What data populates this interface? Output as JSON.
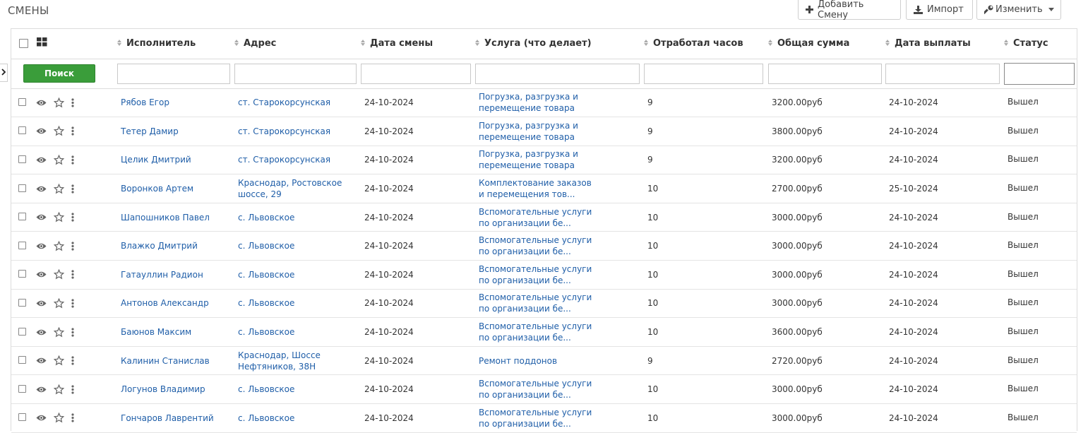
{
  "page": {
    "title": "СМЕНЫ"
  },
  "toolbar": {
    "add_label": "Добавить Смену",
    "import_label": "Импорт",
    "edit_label": "Изменить"
  },
  "search": {
    "button_label": "Поиск"
  },
  "columns": [
    "Исполнитель",
    "Адрес",
    "Дата смены",
    "Услуга (что делает)",
    "Отработал часов",
    "Общая сумма",
    "Дата выплаты",
    "Статус"
  ],
  "rows": [
    {
      "worker": "Рябов Егор",
      "address": "ст. Старокорсунская",
      "date": "24-10-2024",
      "service": "Погрузка, разгрузка и перемещение товара",
      "hours": "9",
      "sum": "3200.00руб",
      "pay_date": "24-10-2024",
      "status": "Вышел"
    },
    {
      "worker": "Тетер Дамир",
      "address": "ст. Старокорсунская",
      "date": "24-10-2024",
      "service": "Погрузка, разгрузка и перемещение товара",
      "hours": "9",
      "sum": "3800.00руб",
      "pay_date": "24-10-2024",
      "status": "Вышел"
    },
    {
      "worker": "Целик Дмитрий",
      "address": "ст. Старокорсунская",
      "date": "24-10-2024",
      "service": "Погрузка, разгрузка и перемещение товара",
      "hours": "9",
      "sum": "3200.00руб",
      "pay_date": "24-10-2024",
      "status": "Вышел"
    },
    {
      "worker": "Воронков Артем",
      "address": "Краснодар, Ростовское шоссе, 29",
      "date": "24-10-2024",
      "service": "Комплектование заказов и перемещения тов...",
      "hours": "10",
      "sum": "2700.00руб",
      "pay_date": "25-10-2024",
      "status": "Вышел"
    },
    {
      "worker": "Шапошников Павел",
      "address": "с. Львовское",
      "date": "24-10-2024",
      "service": "Вспомогательные услуги по организации бе...",
      "hours": "10",
      "sum": "3000.00руб",
      "pay_date": "24-10-2024",
      "status": "Вышел"
    },
    {
      "worker": "Влажко Дмитрий",
      "address": "с. Львовское",
      "date": "24-10-2024",
      "service": "Вспомогательные услуги по организации бе...",
      "hours": "10",
      "sum": "3000.00руб",
      "pay_date": "24-10-2024",
      "status": "Вышел"
    },
    {
      "worker": "Гатауллин Радион",
      "address": "с. Львовское",
      "date": "24-10-2024",
      "service": "Вспомогательные услуги по организации бе...",
      "hours": "10",
      "sum": "3000.00руб",
      "pay_date": "24-10-2024",
      "status": "Вышел"
    },
    {
      "worker": "Антонов Александр",
      "address": "с. Львовское",
      "date": "24-10-2024",
      "service": "Вспомогательные услуги по организации бе...",
      "hours": "10",
      "sum": "3000.00руб",
      "pay_date": "24-10-2024",
      "status": "Вышел"
    },
    {
      "worker": "Баюнов Максим",
      "address": "с. Львовское",
      "date": "24-10-2024",
      "service": "Вспомогательные услуги по организации бе...",
      "hours": "10",
      "sum": "3600.00руб",
      "pay_date": "24-10-2024",
      "status": "Вышел"
    },
    {
      "worker": "Калинин Станислав",
      "address": "Краснодар, Шоссе Нефтяников, 38Н",
      "date": "24-10-2024",
      "service": "Ремонт поддонов",
      "hours": "9",
      "sum": "2720.00руб",
      "pay_date": "24-10-2024",
      "status": "Вышел"
    },
    {
      "worker": "Логунов Владимир",
      "address": "с. Львовское",
      "date": "24-10-2024",
      "service": "Вспомогательные услуги по организации бе...",
      "hours": "10",
      "sum": "3000.00руб",
      "pay_date": "24-10-2024",
      "status": "Вышел"
    },
    {
      "worker": "Гончаров Лаврентий",
      "address": "с. Львовское",
      "date": "24-10-2024",
      "service": "Вспомогательные услуги по организации бе...",
      "hours": "10",
      "sum": "3000.00руб",
      "pay_date": "24-10-2024",
      "status": "Вышел"
    }
  ]
}
